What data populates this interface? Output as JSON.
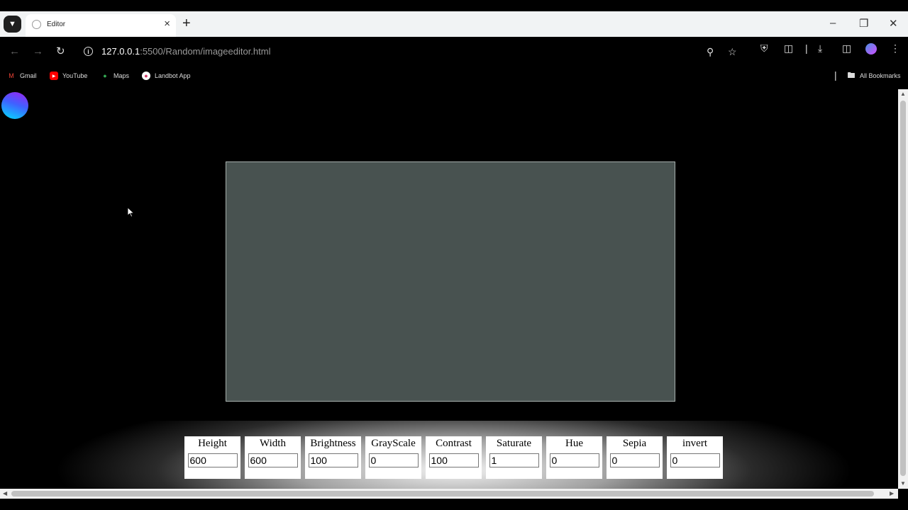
{
  "browser": {
    "tab_title": "Editor",
    "url_host": "127.0.0.1",
    "url_path": ":5500/Random/imageeditor.html",
    "bookmarks": [
      {
        "label": "Gmail",
        "icon": "gmail-icon"
      },
      {
        "label": "YouTube",
        "icon": "youtube-icon"
      },
      {
        "label": "Maps",
        "icon": "maps-icon"
      },
      {
        "label": "Landbot App",
        "icon": "landbot-icon"
      }
    ],
    "all_bookmarks": "All Bookmarks"
  },
  "editor": {
    "canvas_color": "#485250",
    "controls": [
      {
        "label": "Height",
        "value": "600"
      },
      {
        "label": "Width",
        "value": "600"
      },
      {
        "label": "Brightness",
        "value": "100"
      },
      {
        "label": "GrayScale",
        "value": "0"
      },
      {
        "label": "Contrast",
        "value": "100"
      },
      {
        "label": "Saturate",
        "value": "1"
      },
      {
        "label": "Hue",
        "value": "0"
      },
      {
        "label": "Sepia",
        "value": "0"
      },
      {
        "label": "invert",
        "value": "0"
      }
    ]
  }
}
